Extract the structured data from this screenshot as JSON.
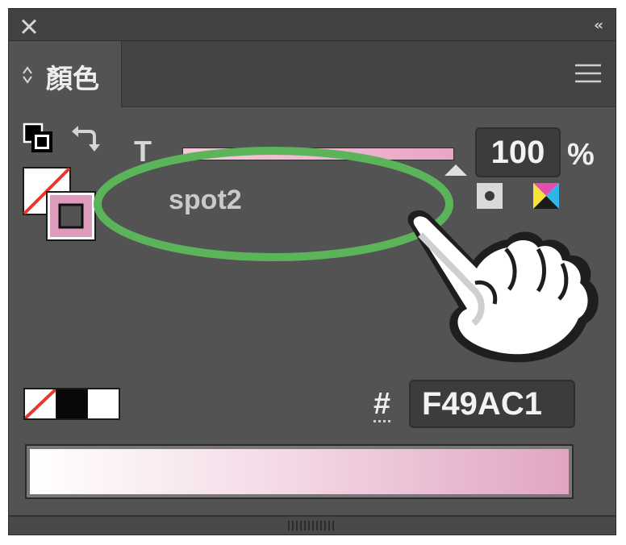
{
  "panel": {
    "tab_label": "顏色",
    "colors": {
      "panel_bg": "#535353",
      "annotation_green": "#5bb45a",
      "fill_color": "#F49AC1"
    }
  },
  "tint": {
    "label": "T",
    "value": "100",
    "unit": "%",
    "level_percent": 100
  },
  "swatch_name": "spot2",
  "hex": {
    "label": "#",
    "value": "F49AC1"
  },
  "icons": {
    "close": "close-icon",
    "collapse": "double-chevron-left-icon",
    "menu": "hamburger-menu-icon",
    "swap": "swap-arrows-icon",
    "default_colors": "default-fill-stroke-icon",
    "spot": "spot-color-icon",
    "process": "process-color-icon"
  }
}
